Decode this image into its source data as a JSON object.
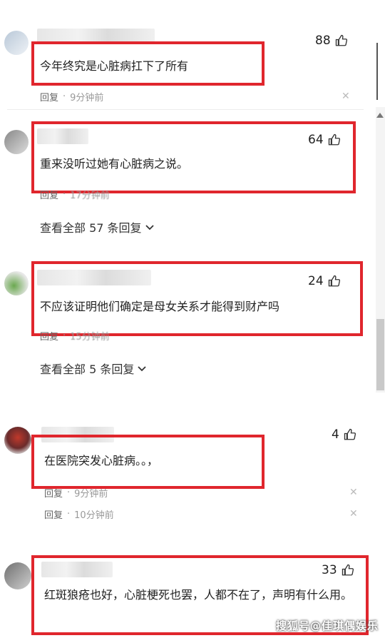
{
  "comments": [
    {
      "likes": "88",
      "text": "今年终究是心脏病扛下了所有",
      "reply": "回复",
      "time": "9分钟前"
    },
    {
      "likes": "64",
      "text": "重来没听过她有心脏病之说。",
      "reply": "回复",
      "time": "17分钟前",
      "view_all": "查看全部 57 条回复"
    },
    {
      "likes": "24",
      "text": "不应该证明他们确定是母女关系才能得到财产吗",
      "reply": "回复",
      "time": "15分钟前",
      "view_all": "查看全部 5 条回复"
    },
    {
      "likes": "4",
      "text": "在医院突发心脏病。。，",
      "reply": "回复",
      "time": "9分钟前"
    },
    {
      "likes": "33",
      "text": "红斑狼疮也好，心脏梗死也罢，人都不在了，声明有什么用。"
    }
  ],
  "extra_meta": {
    "reply": "回复",
    "time": "10分钟前"
  },
  "watermark": "搜狐号@佳琪偶娱乐",
  "icons": {
    "like": "thumbs-up-icon",
    "close": "close-icon",
    "expand": "chevron-down-icon"
  },
  "colors": {
    "highlight": "#e0262d"
  }
}
